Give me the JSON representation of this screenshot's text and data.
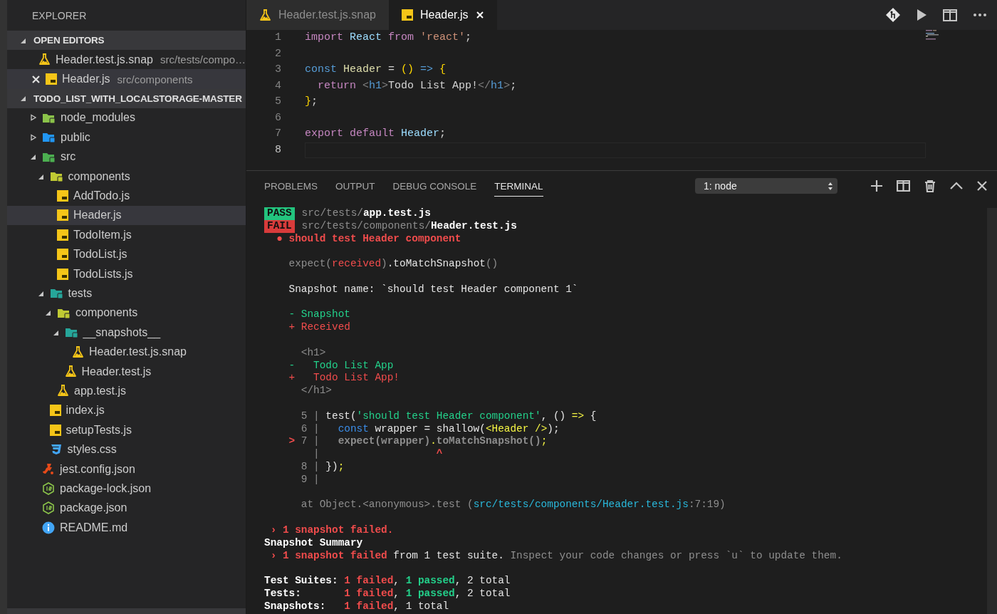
{
  "sidebar": {
    "title": "EXPLORER",
    "open_editors": {
      "title": "OPEN EDITORS",
      "expanded": true,
      "items": [
        {
          "label": "Header.test.js.snap",
          "description": "src/tests/compo…",
          "kind": "flask",
          "selected": false,
          "show_close": false
        },
        {
          "label": "Header.js",
          "description": "src/components",
          "kind": "js",
          "selected": true,
          "show_close": true
        }
      ]
    },
    "folder": {
      "title": "TODO_LIST_WITH_LOCALSTORAGE-MASTER",
      "expanded": true,
      "tree": [
        {
          "label": "node_modules",
          "kind": "folder-node",
          "expanded": false,
          "selected": false
        },
        {
          "label": "public",
          "kind": "folder-public",
          "expanded": false,
          "selected": false
        },
        {
          "label": "src",
          "kind": "folder-src",
          "expanded": true,
          "selected": false,
          "children": [
            {
              "label": "components",
              "kind": "folder-components",
              "expanded": true,
              "selected": false,
              "children": [
                {
                  "label": "AddTodo.js",
                  "kind": "js",
                  "selected": false
                },
                {
                  "label": "Header.js",
                  "kind": "js",
                  "selected": true
                },
                {
                  "label": "TodoItem.js",
                  "kind": "js",
                  "selected": false
                },
                {
                  "label": "TodoList.js",
                  "kind": "js",
                  "selected": false
                },
                {
                  "label": "TodoLists.js",
                  "kind": "js",
                  "selected": false
                }
              ]
            },
            {
              "label": "tests",
              "kind": "folder-tests",
              "expanded": true,
              "selected": false,
              "children": [
                {
                  "label": "components",
                  "kind": "folder-components",
                  "expanded": true,
                  "selected": false,
                  "children": [
                    {
                      "label": "__snapshots__",
                      "kind": "folder-tests",
                      "expanded": true,
                      "selected": false,
                      "children": [
                        {
                          "label": "Header.test.js.snap",
                          "kind": "flask",
                          "selected": false
                        }
                      ]
                    },
                    {
                      "label": "Header.test.js",
                      "kind": "flask",
                      "selected": false
                    }
                  ]
                },
                {
                  "label": "app.test.js",
                  "kind": "flask",
                  "selected": false
                }
              ]
            },
            {
              "label": "index.js",
              "kind": "js",
              "selected": false
            },
            {
              "label": "setupTests.js",
              "kind": "js",
              "selected": false
            },
            {
              "label": "styles.css",
              "kind": "css",
              "selected": false
            }
          ]
        },
        {
          "label": "jest.config.json",
          "kind": "jest",
          "selected": false
        },
        {
          "label": "package-lock.json",
          "kind": "node",
          "selected": false
        },
        {
          "label": "package.json",
          "kind": "node",
          "selected": false
        },
        {
          "label": "README.md",
          "kind": "info",
          "selected": false
        }
      ]
    }
  },
  "editor": {
    "tabs": [
      {
        "label": "Header.test.js.snap",
        "kind": "flask",
        "selected": false
      },
      {
        "label": "Header.js",
        "kind": "js",
        "selected": true
      }
    ],
    "lines": [
      {
        "number": "1",
        "current": false,
        "tokens": [
          {
            "text": "import ",
            "kind": "keyword"
          },
          {
            "text": "React ",
            "kind": "variable"
          },
          {
            "text": "from ",
            "kind": "keyword"
          },
          {
            "text": "'react'",
            "kind": "string"
          },
          {
            "text": ";",
            "kind": "punct"
          }
        ]
      },
      {
        "number": "2",
        "current": false
      },
      {
        "number": "3",
        "current": false,
        "tokens": [
          {
            "text": "const ",
            "kind": "storage"
          },
          {
            "text": "Header ",
            "kind": "function"
          },
          {
            "text": "= ",
            "kind": "punct"
          },
          {
            "text": "() ",
            "kind": "bracket"
          },
          {
            "text": "=> ",
            "kind": "storage"
          },
          {
            "text": "{",
            "kind": "bracket"
          }
        ]
      },
      {
        "number": "4",
        "current": false,
        "tokens": [
          {
            "text": "  return ",
            "kind": "keyword"
          },
          {
            "text": "<",
            "kind": "tagpunct"
          },
          {
            "text": "h1",
            "kind": "tag"
          },
          {
            "text": ">",
            "kind": "tagpunct"
          },
          {
            "text": "Todo List App!",
            "kind": "punct"
          },
          {
            "text": "</",
            "kind": "tagpunct"
          },
          {
            "text": "h1",
            "kind": "tag"
          },
          {
            "text": ">",
            "kind": "tagpunct"
          },
          {
            "text": ";",
            "kind": "punct"
          }
        ]
      },
      {
        "number": "5",
        "current": false,
        "tokens": [
          {
            "text": "}",
            "kind": "bracket"
          },
          {
            "text": ";",
            "kind": "punct"
          }
        ]
      },
      {
        "number": "6",
        "current": false
      },
      {
        "number": "7",
        "current": false,
        "tokens": [
          {
            "text": "export ",
            "kind": "keyword"
          },
          {
            "text": "default ",
            "kind": "keyword"
          },
          {
            "text": "Header",
            "kind": "variable"
          },
          {
            "text": ";",
            "kind": "punct"
          }
        ]
      },
      {
        "number": "8",
        "current": true
      }
    ]
  },
  "panel": {
    "tabs": [
      {
        "label": "PROBLEMS",
        "selected": false
      },
      {
        "label": "OUTPUT",
        "selected": false
      },
      {
        "label": "DEBUG CONSOLE",
        "selected": false
      },
      {
        "label": "TERMINAL",
        "selected": true
      }
    ],
    "terminal_select": "1: node",
    "lines": [
      {
        "kind": "text",
        "badge": {
          "text": "PASS",
          "kind": "pass"
        },
        "segs": [
          {
            "text": "src/tests/",
            "kind": "dim"
          },
          {
            "text": "app.test.js",
            "kind": "bold"
          }
        ]
      },
      {
        "kind": "text",
        "badge": {
          "text": "FAIL",
          "kind": "fail"
        },
        "segs": [
          {
            "text": "src/tests/components/",
            "kind": "dim"
          },
          {
            "text": "Header.test.js",
            "kind": "bold"
          }
        ]
      },
      {
        "kind": "text",
        "segs": [
          {
            "text": "  ● should test Header component",
            "kind": "redb"
          }
        ]
      },
      {
        "kind": "blank"
      },
      {
        "kind": "text",
        "segs": [
          {
            "text": "    expect(",
            "kind": "dim"
          },
          {
            "text": "received",
            "kind": "red"
          },
          {
            "text": ")",
            "kind": "dim"
          },
          {
            "text": ".toMatchSnapshot",
            "kind": "text"
          },
          {
            "text": "()",
            "kind": "dim"
          }
        ]
      },
      {
        "kind": "blank"
      },
      {
        "kind": "text",
        "segs": [
          {
            "text": "    Snapshot name: `should test Header component 1`",
            "kind": "text"
          }
        ]
      },
      {
        "kind": "blank"
      },
      {
        "kind": "text",
        "segs": [
          {
            "text": "    - Snapshot",
            "kind": "green"
          }
        ]
      },
      {
        "kind": "text",
        "segs": [
          {
            "text": "    + Received",
            "kind": "red"
          }
        ]
      },
      {
        "kind": "blank"
      },
      {
        "kind": "text",
        "segs": [
          {
            "text": "      <h1>",
            "kind": "dim"
          }
        ]
      },
      {
        "kind": "text",
        "segs": [
          {
            "text": "    -   Todo List App",
            "kind": "green"
          }
        ]
      },
      {
        "kind": "text",
        "segs": [
          {
            "text": "    +   Todo List App!",
            "kind": "red"
          }
        ]
      },
      {
        "kind": "text",
        "segs": [
          {
            "text": "      </h1>",
            "kind": "dim"
          }
        ]
      },
      {
        "kind": "blank"
      },
      {
        "kind": "text",
        "segs": [
          {
            "text": "      5 | ",
            "kind": "dim"
          },
          {
            "text": "test(",
            "kind": "text"
          },
          {
            "text": "'should test Header component'",
            "kind": "green"
          },
          {
            "text": ", () ",
            "kind": "text"
          },
          {
            "text": "=>",
            "kind": "yellow"
          },
          {
            "text": " {",
            "kind": "text"
          }
        ]
      },
      {
        "kind": "text",
        "segs": [
          {
            "text": "      6 | ",
            "kind": "dim"
          },
          {
            "text": "  const",
            "kind": "blue"
          },
          {
            "text": " wrapper = shallow(",
            "kind": "text"
          },
          {
            "text": "<Header />",
            "kind": "yellow"
          },
          {
            "text": ");",
            "kind": "text"
          }
        ]
      },
      {
        "kind": "text",
        "segs": [
          {
            "text": "    > ",
            "kind": "redb"
          },
          {
            "text": "7 | ",
            "kind": "dim"
          },
          {
            "text": "  expect(wrapper)",
            "kind": "dimb"
          },
          {
            "text": ".",
            "kind": "yellow"
          },
          {
            "text": "toMatchSnapshot()",
            "kind": "dimb"
          },
          {
            "text": ";",
            "kind": "yellow"
          }
        ]
      },
      {
        "kind": "text",
        "segs": [
          {
            "text": "        | ",
            "kind": "dim"
          },
          {
            "text": "                  ^",
            "kind": "redb"
          }
        ]
      },
      {
        "kind": "text",
        "segs": [
          {
            "text": "      8 | ",
            "kind": "dim"
          },
          {
            "text": "})",
            "kind": "text"
          },
          {
            "text": ";",
            "kind": "yellow"
          }
        ]
      },
      {
        "kind": "text",
        "segs": [
          {
            "text": "      9 |",
            "kind": "dim"
          }
        ]
      },
      {
        "kind": "blank"
      },
      {
        "kind": "text",
        "segs": [
          {
            "text": "      at Object.<anonymous>.test (",
            "kind": "dim"
          },
          {
            "text": "src/tests/components/Header.test.js",
            "kind": "cyan"
          },
          {
            "text": ":7:19)",
            "kind": "dim"
          }
        ]
      },
      {
        "kind": "blank"
      },
      {
        "kind": "text",
        "segs": [
          {
            "text": " › 1 snapshot failed.",
            "kind": "redb"
          }
        ]
      },
      {
        "kind": "text",
        "segs": [
          {
            "text": "Snapshot Summary",
            "kind": "bold"
          }
        ]
      },
      {
        "kind": "text",
        "segs": [
          {
            "text": " › 1 snapshot failed",
            "kind": "redb"
          },
          {
            "text": " from 1 test suite.",
            "kind": "text"
          },
          {
            "text": " Inspect your code changes or press `u` to update them.",
            "kind": "dim"
          }
        ]
      },
      {
        "kind": "blank"
      },
      {
        "kind": "text",
        "segs": [
          {
            "text": "Test Suites: ",
            "kind": "bold"
          },
          {
            "text": "1 failed",
            "kind": "redb"
          },
          {
            "text": ", ",
            "kind": "text"
          },
          {
            "text": "1 passed",
            "kind": "greenb"
          },
          {
            "text": ", 2 total",
            "kind": "text"
          }
        ]
      },
      {
        "kind": "text",
        "segs": [
          {
            "text": "Tests:       ",
            "kind": "bold"
          },
          {
            "text": "1 failed",
            "kind": "redb"
          },
          {
            "text": ", ",
            "kind": "text"
          },
          {
            "text": "1 passed",
            "kind": "greenb"
          },
          {
            "text": ", 2 total",
            "kind": "text"
          }
        ]
      },
      {
        "kind": "text",
        "segs": [
          {
            "text": "Snapshots:   ",
            "kind": "bold"
          },
          {
            "text": "1 failed",
            "kind": "redb"
          },
          {
            "text": ", 1 total",
            "kind": "text"
          }
        ]
      }
    ]
  }
}
